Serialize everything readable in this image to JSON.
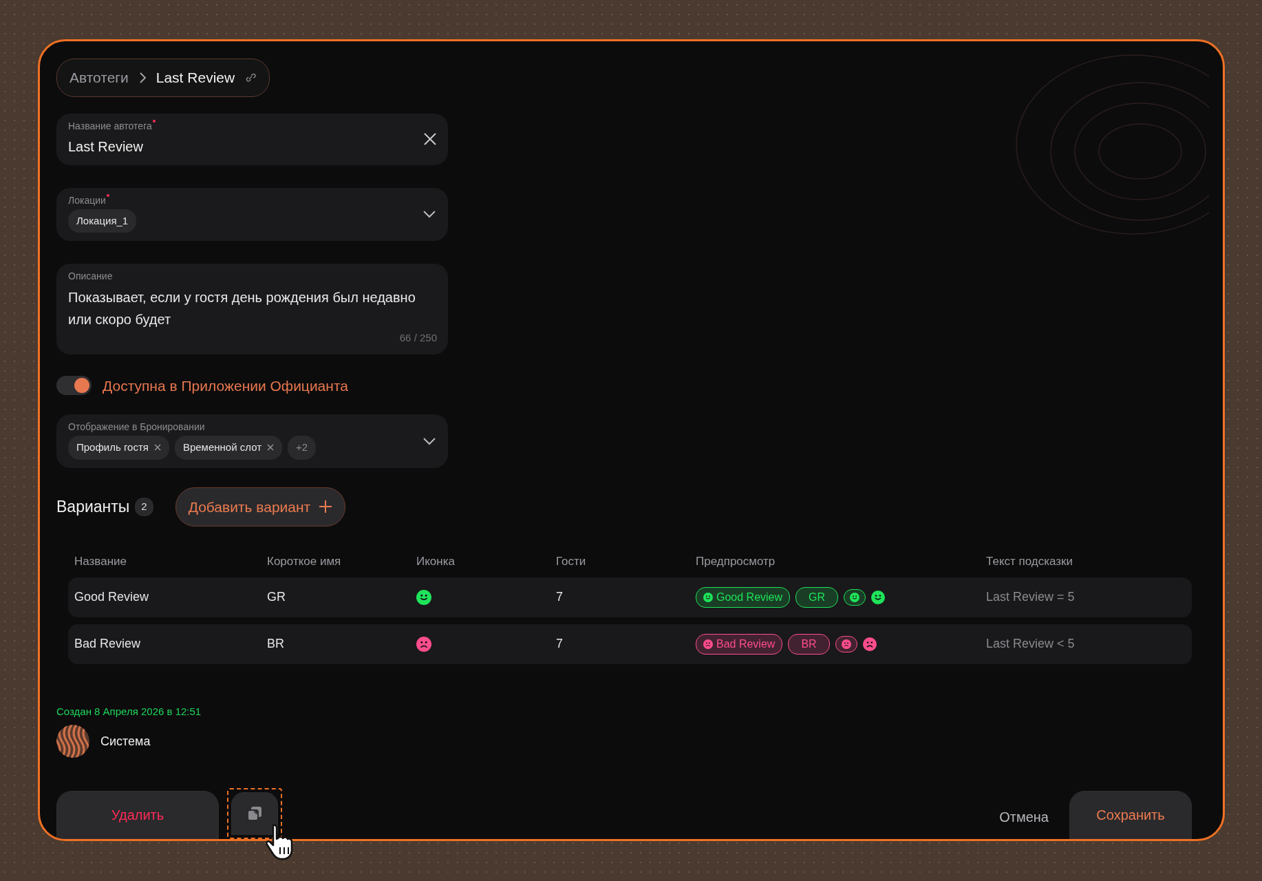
{
  "breadcrumb": {
    "items": [
      "Автотеги",
      "Last Review"
    ]
  },
  "name_field": {
    "label": "Название автотега",
    "required": true,
    "value": "Last Review"
  },
  "locations_field": {
    "label": "Локации",
    "required": true,
    "chips": [
      "Локация_1"
    ]
  },
  "description_field": {
    "label": "Описание",
    "value": "Показывает, если у гостя день рождения был недавно или скоро будет",
    "counter": "66 / 250"
  },
  "waiter_app_toggle": {
    "label": "Доступна в Приложении Официанта",
    "on": true
  },
  "booking_display_field": {
    "label": "Отображение в Бронировании",
    "chips": [
      {
        "label": "Профиль гостя",
        "removable": true
      },
      {
        "label": "Временной слот",
        "removable": true
      }
    ],
    "more": "+2"
  },
  "variants": {
    "title": "Варианты",
    "count": "2",
    "add_button": "Добавить вариант"
  },
  "table": {
    "columns": [
      "Название",
      "Короткое имя",
      "Иконка",
      "Гости",
      "Предпросмотр",
      "Текст подсказки"
    ],
    "rows": [
      {
        "name": "Good Review",
        "short_name": "GR",
        "kind": "happy",
        "color": "#1fe35a",
        "guests": "7",
        "preview_label": "Good Review",
        "preview_short": "GR",
        "hint": "Last Review = 5"
      },
      {
        "name": "Bad Review",
        "short_name": "BR",
        "kind": "sad",
        "color": "#ff4d8d",
        "guests": "7",
        "preview_label": "Bad Review",
        "preview_short": "BR",
        "hint": "Last Review < 5"
      }
    ]
  },
  "created": {
    "text": "Создан 8 Апреля 2026 в 12:51",
    "author": "Система"
  },
  "footer": {
    "delete_button": "Удалить",
    "cancel_button": "Отмена",
    "save_button": "Сохранить"
  }
}
